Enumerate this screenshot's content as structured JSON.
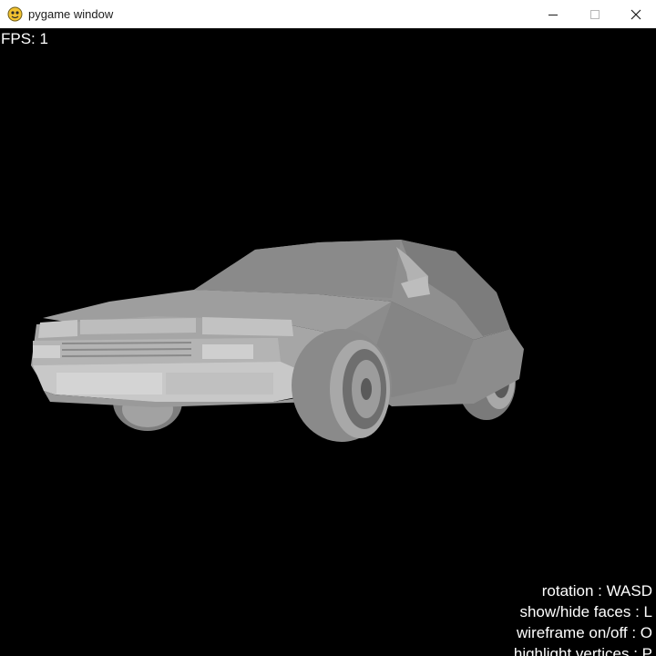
{
  "window": {
    "title": "pygame window",
    "icon": "pygame-snake-icon",
    "controls": {
      "minimize_icon": "minimize-icon",
      "maximize_icon": "maximize-icon",
      "close_icon": "close-icon"
    }
  },
  "hud": {
    "fps": "FPS: 1"
  },
  "scene": {
    "object": "car-3d-model",
    "background_color": "#000000",
    "shading_color": "#9a9a9a"
  },
  "help": {
    "rotation": "rotation : WASD",
    "faces": "show/hide faces : L",
    "wireframe": "wireframe on/off : O",
    "vertices": "highlight vertices : P"
  }
}
